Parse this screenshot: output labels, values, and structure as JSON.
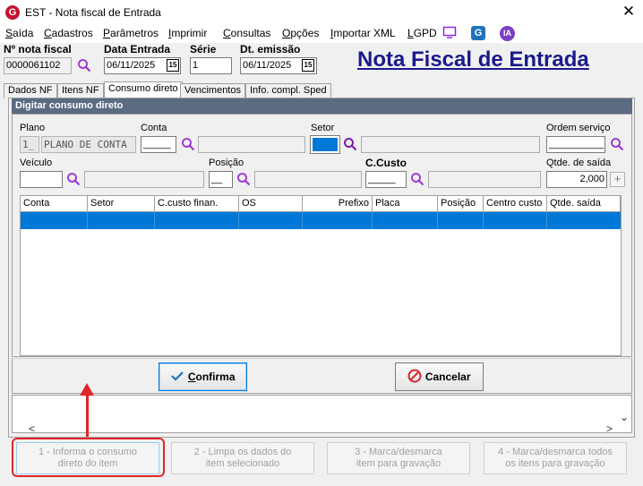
{
  "window": {
    "logo": "G",
    "title": "EST - Nota fiscal de Entrada",
    "close": "✕"
  },
  "menu": {
    "items": [
      {
        "label": "Saída",
        "u": "S",
        "rest": "aída"
      },
      {
        "label": "Cadastros",
        "u": "C",
        "rest": "adastros"
      },
      {
        "label": "Parâmetros",
        "u": "P",
        "rest": "arâmetros"
      },
      {
        "label": "Imprimir",
        "u": "I",
        "rest": "mprimir"
      },
      {
        "label": "Consultas",
        "u": "C",
        "rest": "onsultas"
      },
      {
        "label": "Opções",
        "u": "O",
        "rest": "pções"
      },
      {
        "label": "Importar XML",
        "u": "I",
        "rest": "mportar XML"
      },
      {
        "label": "LGPD",
        "u": "L",
        "rest": "GPD"
      }
    ],
    "icons": [
      "monitor-icon",
      "g-logo-icon",
      "ia-icon"
    ],
    "ia_text": "IA",
    "g_text": "G"
  },
  "header": {
    "nota_label": "Nº nota fiscal",
    "nota_value": "0000061102",
    "data_entrada_label": "Data Entrada",
    "data_entrada_value": "06/11/2025",
    "serie_label": "Série",
    "serie_value": "1",
    "dt_emissao_label": "Dt. emissão",
    "dt_emissao_value": "06/11/2025",
    "cal_text": "15",
    "page_title": "Nota Fiscal de Entrada"
  },
  "tabs": [
    "Dados NF",
    "Itens NF",
    "Consumo direto",
    "Vencimentos",
    "Info. compl. Sped"
  ],
  "panel": {
    "title": "Digitar consumo direto",
    "plano_label": "Plano",
    "plano_code": "1_",
    "plano_desc": "PLANO DE CONTA",
    "conta_label": "Conta",
    "conta_value": "_____",
    "setor_label": "Setor",
    "ordem_label": "Ordem serviço",
    "ordem_value": "__________",
    "veiculo_label": "Veículo",
    "posicao_label": "Posição",
    "posicao_value": "__",
    "ccusto_label": "C.Custo",
    "ccusto_value": "_____",
    "qtde_label": "Qtde. de saída",
    "qtde_value": "2,000",
    "plus": "+"
  },
  "grid": {
    "columns": [
      "Conta",
      "Setor",
      "C.custo finan.",
      "OS",
      "Prefixo",
      "Placa",
      "Posição",
      "Centro custo",
      "Qtde. saída"
    ]
  },
  "buttons": {
    "confirma": "Confirma",
    "confirma_u": "C",
    "confirma_rest": "onfirma",
    "cancelar": "Cancelar"
  },
  "scroll": {
    "left": "<",
    "right": ">",
    "down": "⌄"
  },
  "actions": [
    {
      "line1": "1 - Informa o consumo",
      "line2": "direto do item"
    },
    {
      "line1": "2 - Limpa os dados do",
      "line2": "item selecionado"
    },
    {
      "line1": "3 - Marca/desmarca",
      "line2": "item para gravação"
    },
    {
      "line1": "4 - Marca/desmarca todos",
      "line2": "os itens para gravação"
    }
  ],
  "colors": {
    "accent": "#0078d7",
    "title": "#1a1a8c",
    "header_bar": "#5a6b82",
    "highlight": "#e0262a"
  }
}
